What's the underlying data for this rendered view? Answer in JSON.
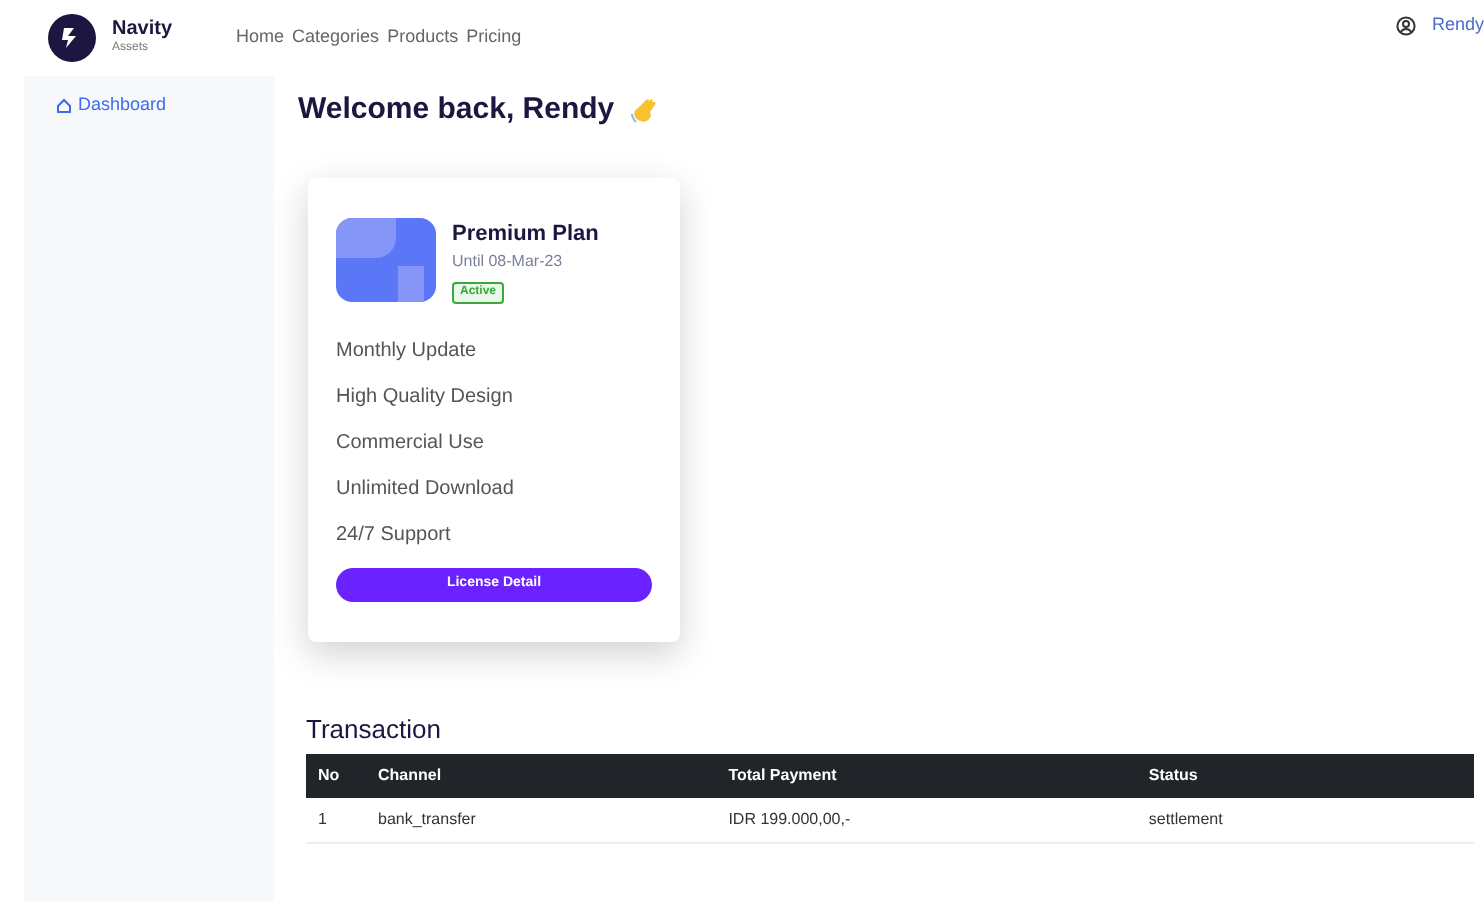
{
  "brand": {
    "name": "Navity",
    "tagline": "Assets"
  },
  "nav": [
    "Home",
    "Categories",
    "Products",
    "Pricing"
  ],
  "user": {
    "name": "Rendy"
  },
  "sidebar": {
    "items": [
      {
        "label": "Dashboard",
        "selected": true
      }
    ]
  },
  "heading": "Welcome back, Rendy",
  "plan": {
    "title": "Premium Plan",
    "until": "Until 08-Mar-23",
    "status": "Active",
    "features": [
      "Monthly Update",
      "High Quality Design",
      "Commercial Use",
      "Unlimited Download",
      "24/7 Support"
    ],
    "button": "License Detail"
  },
  "transactions": {
    "title": "Transaction",
    "columns": [
      "No",
      "Channel",
      "Total Payment",
      "Status"
    ],
    "rows": [
      [
        "1",
        "bank_transfer",
        "IDR 199.000,00,-",
        "settlement"
      ]
    ]
  }
}
